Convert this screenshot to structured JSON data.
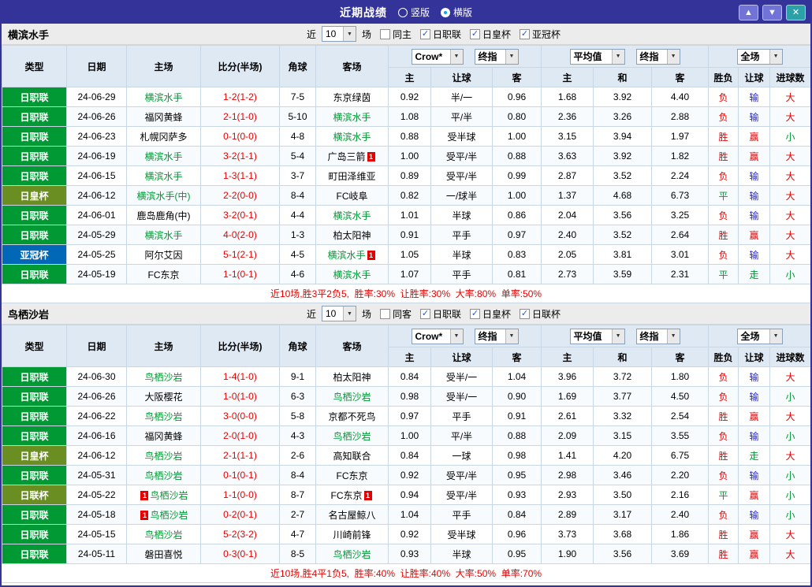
{
  "titlebar": {
    "title": "近期战绩",
    "layout_options": [
      {
        "label": "竖版",
        "selected": false
      },
      {
        "label": "横版",
        "selected": true
      }
    ],
    "window_buttons": [
      {
        "name": "scroll-up-button",
        "glyph": "▲",
        "color": "#7173d6"
      },
      {
        "name": "scroll-down-button",
        "glyph": "▼",
        "color": "#7173d6"
      },
      {
        "name": "close-button",
        "glyph": "✕",
        "color": "#2ba0a6"
      }
    ]
  },
  "filters": {
    "prefix": "近",
    "suffix": "场"
  },
  "table": {
    "main_headers": [
      "类型",
      "日期",
      "主场",
      "比分(半场)",
      "角球",
      "客场"
    ],
    "sub_headers": [
      "主",
      "让球",
      "客",
      "主",
      "和",
      "客",
      "胜负",
      "让球",
      "进球数"
    ],
    "asia_selects": [
      "Crow*",
      "终指"
    ],
    "euro_selects": [
      "平均值",
      "终指"
    ],
    "result_selects": [
      "全场"
    ]
  },
  "league_colors": {
    "日职联": "#009933",
    "日皇杯": "#6b8e23",
    "日联杯": "#6b8e23",
    "亚冠杯": "#0068b7"
  },
  "result_colors": {
    "red": "#e60000",
    "blue": "#2222cc",
    "green": "#009933"
  },
  "sections": [
    {
      "team": "横滨水手",
      "recent_count": "10",
      "venue_filter": {
        "label": "同主",
        "checked": false
      },
      "league_filters": [
        {
          "label": "日职联",
          "checked": true
        },
        {
          "label": "日皇杯",
          "checked": true
        },
        {
          "label": "亚冠杯",
          "checked": true
        }
      ],
      "rows": [
        {
          "league": "日职联",
          "date": "24-06-29",
          "home": {
            "name": "横滨水手",
            "focus": true
          },
          "score": "1-2(1-2)",
          "corners": "7-5",
          "away": {
            "name": "东京绿茵",
            "focus": false
          },
          "asia": [
            "0.92",
            "半/一",
            "0.96"
          ],
          "euro": [
            "1.68",
            "3.92",
            "4.40"
          ],
          "results": [
            [
              "负",
              "red"
            ],
            [
              "输",
              "blue"
            ],
            [
              "大",
              "red"
            ]
          ]
        },
        {
          "league": "日职联",
          "date": "24-06-26",
          "home": {
            "name": "福冈黄蜂",
            "focus": false
          },
          "score": "2-1(1-0)",
          "corners": "5-10",
          "away": {
            "name": "横滨水手",
            "focus": true
          },
          "asia": [
            "1.08",
            "平/半",
            "0.80"
          ],
          "euro": [
            "2.36",
            "3.26",
            "2.88"
          ],
          "results": [
            [
              "负",
              "red"
            ],
            [
              "输",
              "blue"
            ],
            [
              "大",
              "red"
            ]
          ]
        },
        {
          "league": "日职联",
          "date": "24-06-23",
          "home": {
            "name": "札幌冈萨多",
            "focus": false
          },
          "score": "0-1(0-0)",
          "corners": "4-8",
          "away": {
            "name": "横滨水手",
            "focus": true
          },
          "asia": [
            "0.88",
            "受半球",
            "1.00"
          ],
          "euro": [
            "3.15",
            "3.94",
            "1.97"
          ],
          "results": [
            [
              "胜",
              "red"
            ],
            [
              "赢",
              "red"
            ],
            [
              "小",
              "green"
            ]
          ]
        },
        {
          "league": "日职联",
          "date": "24-06-19",
          "home": {
            "name": "横滨水手",
            "focus": true
          },
          "score": "3-2(1-1)",
          "corners": "5-4",
          "away": {
            "name": "广岛三箭",
            "focus": false,
            "badge": {
              "text": "1",
              "pos": "after"
            }
          },
          "asia": [
            "1.00",
            "受平/半",
            "0.88"
          ],
          "euro": [
            "3.63",
            "3.92",
            "1.82"
          ],
          "results": [
            [
              "胜",
              "red"
            ],
            [
              "赢",
              "red"
            ],
            [
              "大",
              "red"
            ]
          ]
        },
        {
          "league": "日职联",
          "date": "24-06-15",
          "home": {
            "name": "横滨水手",
            "focus": true
          },
          "score": "1-3(1-1)",
          "corners": "3-7",
          "away": {
            "name": "町田泽维亚",
            "focus": false
          },
          "asia": [
            "0.89",
            "受平/半",
            "0.99"
          ],
          "euro": [
            "2.87",
            "3.52",
            "2.24"
          ],
          "results": [
            [
              "负",
              "red"
            ],
            [
              "输",
              "blue"
            ],
            [
              "大",
              "red"
            ]
          ]
        },
        {
          "league": "日皇杯",
          "date": "24-06-12",
          "home": {
            "name": "横滨水手(中)",
            "focus": true
          },
          "score": "2-2(0-0)",
          "corners": "8-4",
          "away": {
            "name": "FC岐阜",
            "focus": false
          },
          "asia": [
            "0.82",
            "一/球半",
            "1.00"
          ],
          "euro": [
            "1.37",
            "4.68",
            "6.73"
          ],
          "results": [
            [
              "平",
              "green"
            ],
            [
              "输",
              "blue"
            ],
            [
              "大",
              "red"
            ]
          ]
        },
        {
          "league": "日职联",
          "date": "24-06-01",
          "home": {
            "name": "鹿岛鹿角(中)",
            "focus": false
          },
          "score": "3-2(0-1)",
          "corners": "4-4",
          "away": {
            "name": "横滨水手",
            "focus": true
          },
          "asia": [
            "1.01",
            "半球",
            "0.86"
          ],
          "euro": [
            "2.04",
            "3.56",
            "3.25"
          ],
          "results": [
            [
              "负",
              "red"
            ],
            [
              "输",
              "blue"
            ],
            [
              "大",
              "red"
            ]
          ]
        },
        {
          "league": "日职联",
          "date": "24-05-29",
          "home": {
            "name": "横滨水手",
            "focus": true
          },
          "score": "4-0(2-0)",
          "corners": "1-3",
          "away": {
            "name": "柏太阳神",
            "focus": false
          },
          "asia": [
            "0.91",
            "平手",
            "0.97"
          ],
          "euro": [
            "2.40",
            "3.52",
            "2.64"
          ],
          "results": [
            [
              "胜",
              "red"
            ],
            [
              "赢",
              "red"
            ],
            [
              "大",
              "red"
            ]
          ]
        },
        {
          "league": "亚冠杯",
          "date": "24-05-25",
          "home": {
            "name": "阿尔艾因",
            "focus": false
          },
          "score": "5-1(2-1)",
          "corners": "4-5",
          "away": {
            "name": "横滨水手",
            "focus": true,
            "badge": {
              "text": "1",
              "pos": "after"
            }
          },
          "asia": [
            "1.05",
            "半球",
            "0.83"
          ],
          "euro": [
            "2.05",
            "3.81",
            "3.01"
          ],
          "results": [
            [
              "负",
              "red"
            ],
            [
              "输",
              "blue"
            ],
            [
              "大",
              "red"
            ]
          ]
        },
        {
          "league": "日职联",
          "date": "24-05-19",
          "home": {
            "name": "FC东京",
            "focus": false
          },
          "score": "1-1(0-1)",
          "corners": "4-6",
          "away": {
            "name": "横滨水手",
            "focus": true
          },
          "asia": [
            "1.07",
            "平手",
            "0.81"
          ],
          "euro": [
            "2.73",
            "3.59",
            "2.31"
          ],
          "results": [
            [
              "平",
              "green"
            ],
            [
              "走",
              "green"
            ],
            [
              "小",
              "green"
            ]
          ]
        }
      ],
      "summary": "近10场,胜3平2负5,  胜率:30%  让胜率:30%  大率:80%  单率:50%"
    },
    {
      "team": "鸟栖沙岩",
      "recent_count": "10",
      "venue_filter": {
        "label": "同客",
        "checked": false
      },
      "league_filters": [
        {
          "label": "日职联",
          "checked": true
        },
        {
          "label": "日皇杯",
          "checked": true
        },
        {
          "label": "日联杯",
          "checked": true
        }
      ],
      "rows": [
        {
          "league": "日职联",
          "date": "24-06-30",
          "home": {
            "name": "鸟栖沙岩",
            "focus": true
          },
          "score": "1-4(1-0)",
          "corners": "9-1",
          "away": {
            "name": "柏太阳神",
            "focus": false
          },
          "asia": [
            "0.84",
            "受半/一",
            "1.04"
          ],
          "euro": [
            "3.96",
            "3.72",
            "1.80"
          ],
          "results": [
            [
              "负",
              "red"
            ],
            [
              "输",
              "blue"
            ],
            [
              "大",
              "red"
            ]
          ]
        },
        {
          "league": "日职联",
          "date": "24-06-26",
          "home": {
            "name": "大阪樱花",
            "focus": false
          },
          "score": "1-0(1-0)",
          "corners": "6-3",
          "away": {
            "name": "鸟栖沙岩",
            "focus": true
          },
          "asia": [
            "0.98",
            "受半/一",
            "0.90"
          ],
          "euro": [
            "1.69",
            "3.77",
            "4.50"
          ],
          "results": [
            [
              "负",
              "red"
            ],
            [
              "输",
              "blue"
            ],
            [
              "小",
              "green"
            ]
          ]
        },
        {
          "league": "日职联",
          "date": "24-06-22",
          "home": {
            "name": "鸟栖沙岩",
            "focus": true
          },
          "score": "3-0(0-0)",
          "corners": "5-8",
          "away": {
            "name": "京都不死鸟",
            "focus": false
          },
          "asia": [
            "0.97",
            "平手",
            "0.91"
          ],
          "euro": [
            "2.61",
            "3.32",
            "2.54"
          ],
          "results": [
            [
              "胜",
              "red"
            ],
            [
              "赢",
              "red"
            ],
            [
              "大",
              "red"
            ]
          ]
        },
        {
          "league": "日职联",
          "date": "24-06-16",
          "home": {
            "name": "福冈黄蜂",
            "focus": false
          },
          "score": "2-0(1-0)",
          "corners": "4-3",
          "away": {
            "name": "鸟栖沙岩",
            "focus": true
          },
          "asia": [
            "1.00",
            "平/半",
            "0.88"
          ],
          "euro": [
            "2.09",
            "3.15",
            "3.55"
          ],
          "results": [
            [
              "负",
              "red"
            ],
            [
              "输",
              "blue"
            ],
            [
              "小",
              "green"
            ]
          ]
        },
        {
          "league": "日皇杯",
          "date": "24-06-12",
          "home": {
            "name": "鸟栖沙岩",
            "focus": true
          },
          "score": "2-1(1-1)",
          "corners": "2-6",
          "away": {
            "name": "高知联合",
            "focus": false
          },
          "asia": [
            "0.84",
            "一球",
            "0.98"
          ],
          "euro": [
            "1.41",
            "4.20",
            "6.75"
          ],
          "results": [
            [
              "胜",
              "red"
            ],
            [
              "走",
              "green"
            ],
            [
              "大",
              "red"
            ]
          ]
        },
        {
          "league": "日职联",
          "date": "24-05-31",
          "home": {
            "name": "鸟栖沙岩",
            "focus": true
          },
          "score": "0-1(0-1)",
          "corners": "8-4",
          "away": {
            "name": "FC东京",
            "focus": false
          },
          "asia": [
            "0.92",
            "受平/半",
            "0.95"
          ],
          "euro": [
            "2.98",
            "3.46",
            "2.20"
          ],
          "results": [
            [
              "负",
              "red"
            ],
            [
              "输",
              "blue"
            ],
            [
              "小",
              "green"
            ]
          ]
        },
        {
          "league": "日联杯",
          "date": "24-05-22",
          "home": {
            "name": "鸟栖沙岩",
            "focus": true,
            "badge": {
              "text": "1",
              "pos": "before"
            }
          },
          "score": "1-1(0-0)",
          "corners": "8-7",
          "away": {
            "name": "FC东京",
            "focus": false,
            "badge": {
              "text": "1",
              "pos": "after"
            }
          },
          "asia": [
            "0.94",
            "受平/半",
            "0.93"
          ],
          "euro": [
            "2.93",
            "3.50",
            "2.16"
          ],
          "results": [
            [
              "平",
              "green"
            ],
            [
              "赢",
              "red"
            ],
            [
              "小",
              "green"
            ]
          ]
        },
        {
          "league": "日职联",
          "date": "24-05-18",
          "home": {
            "name": "鸟栖沙岩",
            "focus": true,
            "badge": {
              "text": "1",
              "pos": "before"
            }
          },
          "score": "0-2(0-1)",
          "corners": "2-7",
          "away": {
            "name": "名古屋鲸八",
            "focus": false
          },
          "asia": [
            "1.04",
            "平手",
            "0.84"
          ],
          "euro": [
            "2.89",
            "3.17",
            "2.40"
          ],
          "results": [
            [
              "负",
              "red"
            ],
            [
              "输",
              "blue"
            ],
            [
              "小",
              "green"
            ]
          ]
        },
        {
          "league": "日职联",
          "date": "24-05-15",
          "home": {
            "name": "鸟栖沙岩",
            "focus": true
          },
          "score": "5-2(3-2)",
          "corners": "4-7",
          "away": {
            "name": "川崎前锋",
            "focus": false
          },
          "asia": [
            "0.92",
            "受半球",
            "0.96"
          ],
          "euro": [
            "3.73",
            "3.68",
            "1.86"
          ],
          "results": [
            [
              "胜",
              "red"
            ],
            [
              "赢",
              "red"
            ],
            [
              "大",
              "red"
            ]
          ]
        },
        {
          "league": "日职联",
          "date": "24-05-11",
          "home": {
            "name": "磐田喜悦",
            "focus": false
          },
          "score": "0-3(0-1)",
          "corners": "8-5",
          "away": {
            "name": "鸟栖沙岩",
            "focus": true
          },
          "asia": [
            "0.93",
            "半球",
            "0.95"
          ],
          "euro": [
            "1.90",
            "3.56",
            "3.69"
          ],
          "results": [
            [
              "胜",
              "red"
            ],
            [
              "赢",
              "red"
            ],
            [
              "大",
              "red"
            ]
          ]
        }
      ],
      "summary": "近10场,胜4平1负5,  胜率:40%  让胜率:40%  大率:50%  单率:70%"
    }
  ]
}
